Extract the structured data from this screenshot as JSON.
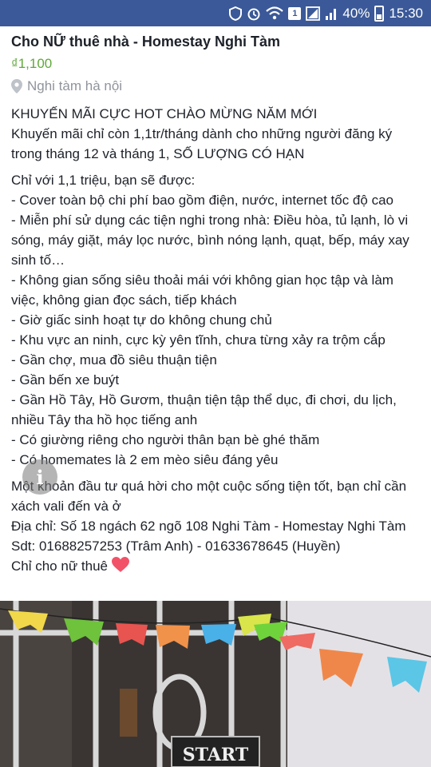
{
  "status_bar": {
    "battery": "40%",
    "time": "15:30",
    "sim": "1",
    "icons": [
      "shield-icon",
      "alarm-icon",
      "wifi-icon",
      "sim-icon",
      "signal-icon",
      "battery-icon"
    ]
  },
  "post": {
    "title": "Cho NỮ thuê nhà - Homestay Nghi Tàm",
    "price": "₫1,100",
    "location": "Nghi tàm hà nội",
    "paragraphs": [
      [
        "KHUYẾN MÃI CỰC HOT CHÀO MỪNG NĂM MỚI",
        "Khuyến mãi chỉ còn 1,1tr/tháng dành cho những người đăng ký trong tháng 12 và tháng 1, SỐ LƯỢNG CÓ HẠN"
      ],
      [
        "Chỉ với 1,1 triệu, bạn sẽ được:",
        "- Cover toàn bộ chi phí bao gồm điện, nước, internet tốc độ cao",
        "- Miễn phí sử dụng các tiện nghi trong nhà: Điều hòa, tủ lạnh, lò vi sóng, máy giặt, máy lọc nước, bình nóng lạnh, quạt, bếp, máy xay sinh tố…",
        "- Không gian sống siêu thoải mái với không gian học tập và làm việc, không gian đọc sách, tiếp khách",
        "- Giờ giấc sinh hoạt tự do không chung chủ",
        "- Khu vực an ninh, cực kỳ yên tĩnh, chưa từng xảy ra trộm cắp",
        "- Gần chợ, mua đồ siêu thuận tiện",
        "- Gần bến xe buýt",
        "- Gần Hồ Tây, Hồ Gươm, thuận tiện tập thể dục, đi chơi, du lịch, nhiều Tây tha hồ học tiếng anh",
        "- Có giường riêng cho người thân bạn bè ghé thăm",
        "- Có homemates là 2 em mèo siêu đáng yêu"
      ],
      [
        "Một khoản đầu tư quá hời cho một cuộc sống tiện tốt, bạn chỉ cần xách vali đến và ở",
        "Địa chỉ: Số 18 ngách 62 ngõ 108 Nghi Tàm - Homestay Nghi Tàm",
        "Sdt: 01688257253 (Trâm Anh) - 01633678645 (Huyền)",
        "Chỉ cho nữ thuê"
      ]
    ],
    "photo_sign": "START",
    "info_label": "i"
  },
  "colors": {
    "status_bar": "#3b5998",
    "price": "#60a83a",
    "muted": "#90949c",
    "heart": "#f25268"
  }
}
